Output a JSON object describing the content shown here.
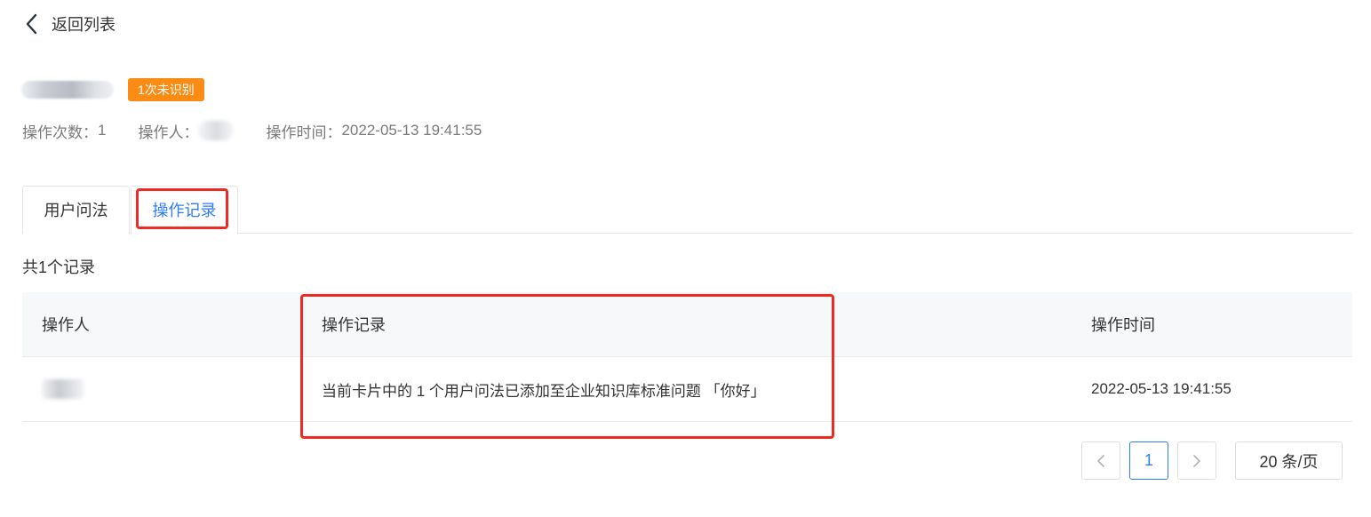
{
  "header": {
    "back_label": "返回列表",
    "badge": "1次未识别"
  },
  "meta": {
    "count_label": "操作次数：",
    "count_value": "1",
    "operator_label": "操作人：",
    "time_label": "操作时间：",
    "time_value": "2022-05-13 19:41:55"
  },
  "tabs": [
    {
      "label": "用户问法",
      "active": false
    },
    {
      "label": "操作记录",
      "active": true
    }
  ],
  "records": {
    "total": "共1个记录",
    "columns": [
      "操作人",
      "操作记录",
      "操作时间"
    ],
    "rows": [
      {
        "record": "当前卡片中的 1 个用户问法已添加至企业知识库标准问题 「你好」",
        "time": "2022-05-13 19:41:55"
      }
    ]
  },
  "pagination": {
    "current_page": "1",
    "page_size": "20 条/页"
  },
  "colors": {
    "accent": "#2f7cf6",
    "badge": "#fa8c16",
    "highlight": "#ee2a24"
  }
}
